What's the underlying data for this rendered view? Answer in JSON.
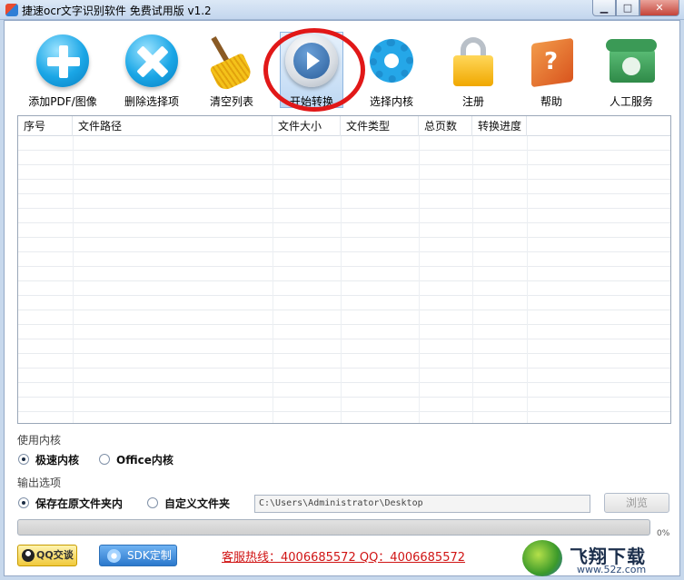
{
  "window": {
    "title": "捷速ocr文字识别软件 免费试用版 v1.2",
    "min_label": "▁",
    "max_label": "□",
    "close_label": "✕"
  },
  "toolbar": {
    "items": [
      {
        "label": "添加PDF/图像",
        "icon": "plus-icon"
      },
      {
        "label": "删除选择项",
        "icon": "delete-icon"
      },
      {
        "label": "清空列表",
        "icon": "broom-icon"
      },
      {
        "label": "开始转换",
        "icon": "play-icon"
      },
      {
        "label": "选择内核",
        "icon": "gear-icon"
      },
      {
        "label": "注册",
        "icon": "lock-icon"
      },
      {
        "label": "帮助",
        "icon": "help-book-icon"
      },
      {
        "label": "人工服务",
        "icon": "phone-icon"
      }
    ]
  },
  "table": {
    "columns": [
      "序号",
      "文件路径",
      "文件大小",
      "文件类型",
      "总页数",
      "转换进度"
    ],
    "rows": []
  },
  "engine": {
    "title": "使用内核",
    "options": [
      "极速内核",
      "Office内核"
    ],
    "selected": "极速内核"
  },
  "output": {
    "title": "输出选项",
    "options": [
      "保存在原文件夹内",
      "自定义文件夹"
    ],
    "selected": "保存在原文件夹内",
    "path": "C:\\Users\\Administrator\\Desktop",
    "browse_label": "浏览",
    "percent": "0%"
  },
  "footer": {
    "qq_label": "QQ交谈",
    "sdk_label": "SDK定制",
    "hotline": "客服热线：4006685572 QQ：4006685572"
  },
  "watermark": {
    "name": "飞翔下载",
    "url": "www.52z.com"
  },
  "colors": {
    "accent": "#1aa6e6",
    "highlight_ring": "#e11818",
    "hotline": "#d01414"
  }
}
